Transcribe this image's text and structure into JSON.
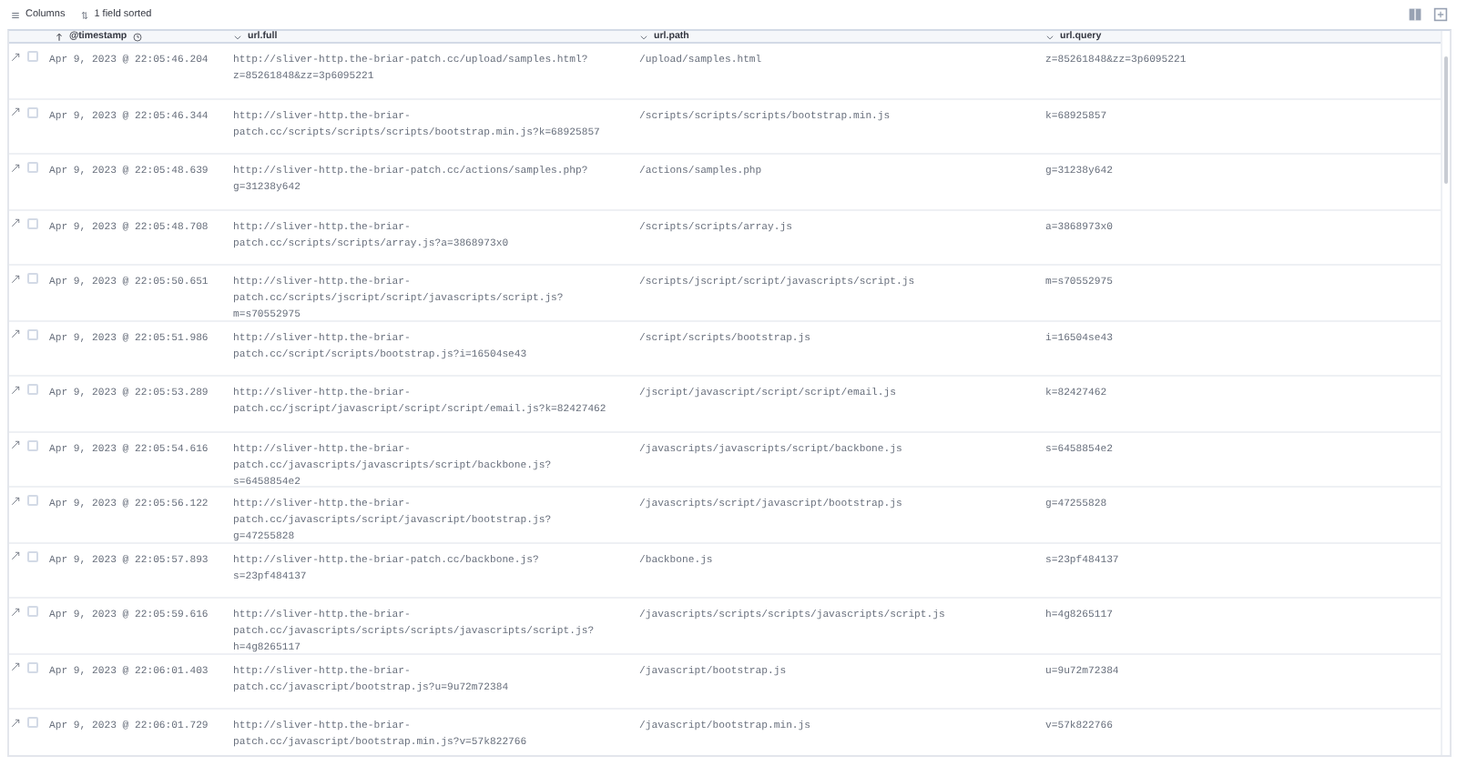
{
  "toolbar": {
    "columns_button": "Columns",
    "sort_button": "1 field sorted"
  },
  "table": {
    "columns": [
      {
        "label": "@timestamp",
        "sorted": true
      },
      {
        "label": "url.full",
        "sorted": false
      },
      {
        "label": "url.path",
        "sorted": false
      },
      {
        "label": "url.query",
        "sorted": false
      }
    ],
    "rows": [
      {
        "checked": false,
        "timestamp": "Apr 9, 2023 @ 22:05:46.204",
        "url_full": "http://sliver-http.the-briar-patch.cc/upload/samples.html?z=85261848&zz=3p6095221",
        "url_path": "/upload/samples.html",
        "url_query": "z=85261848&zz=3p6095221"
      },
      {
        "checked": false,
        "timestamp": "Apr 9, 2023 @ 22:05:46.344",
        "url_full": "http://sliver-http.the-briar-patch.cc/scripts/scripts/scripts/bootstrap.min.js?k=68925857",
        "url_path": "/scripts/scripts/scripts/bootstrap.min.js",
        "url_query": "k=68925857"
      },
      {
        "checked": false,
        "timestamp": "Apr 9, 2023 @ 22:05:48.639",
        "url_full": "http://sliver-http.the-briar-patch.cc/actions/samples.php?g=31238y642",
        "url_path": "/actions/samples.php",
        "url_query": "g=31238y642"
      },
      {
        "checked": false,
        "timestamp": "Apr 9, 2023 @ 22:05:48.708",
        "url_full": "http://sliver-http.the-briar-patch.cc/scripts/scripts/array.js?a=3868973x0",
        "url_path": "/scripts/scripts/array.js",
        "url_query": "a=3868973x0"
      },
      {
        "checked": false,
        "timestamp": "Apr 9, 2023 @ 22:05:50.651",
        "url_full": "http://sliver-http.the-briar-patch.cc/scripts/jscript/script/javascripts/script.js?m=s70552975",
        "url_path": "/scripts/jscript/script/javascripts/script.js",
        "url_query": "m=s70552975"
      },
      {
        "checked": false,
        "timestamp": "Apr 9, 2023 @ 22:05:51.986",
        "url_full": "http://sliver-http.the-briar-patch.cc/script/scripts/bootstrap.js?i=16504se43",
        "url_path": "/script/scripts/bootstrap.js",
        "url_query": "i=16504se43"
      },
      {
        "checked": false,
        "timestamp": "Apr 9, 2023 @ 22:05:53.289",
        "url_full": "http://sliver-http.the-briar-patch.cc/jscript/javascript/script/script/email.js?k=82427462",
        "url_path": "/jscript/javascript/script/script/email.js",
        "url_query": "k=82427462"
      },
      {
        "checked": false,
        "timestamp": "Apr 9, 2023 @ 22:05:54.616",
        "url_full": "http://sliver-http.the-briar-patch.cc/javascripts/javascripts/script/backbone.js?s=6458854e2",
        "url_path": "/javascripts/javascripts/script/backbone.js",
        "url_query": "s=6458854e2"
      },
      {
        "checked": false,
        "timestamp": "Apr 9, 2023 @ 22:05:56.122",
        "url_full": "http://sliver-http.the-briar-patch.cc/javascripts/script/javascript/bootstrap.js?g=47255828",
        "url_path": "/javascripts/script/javascript/bootstrap.js",
        "url_query": "g=47255828"
      },
      {
        "checked": false,
        "timestamp": "Apr 9, 2023 @ 22:05:57.893",
        "url_full": "http://sliver-http.the-briar-patch.cc/backbone.js?s=23pf484137",
        "url_path": "/backbone.js",
        "url_query": "s=23pf484137"
      },
      {
        "checked": false,
        "timestamp": "Apr 9, 2023 @ 22:05:59.616",
        "url_full": "http://sliver-http.the-briar-patch.cc/javascripts/scripts/scripts/javascripts/script.js?h=4g8265117",
        "url_path": "/javascripts/scripts/scripts/javascripts/script.js",
        "url_query": "h=4g8265117"
      },
      {
        "checked": false,
        "timestamp": "Apr 9, 2023 @ 22:06:01.403",
        "url_full": "http://sliver-http.the-briar-patch.cc/javascript/bootstrap.js?u=9u72m72384",
        "url_path": "/javascript/bootstrap.js",
        "url_query": "u=9u72m72384"
      },
      {
        "checked": false,
        "timestamp": "Apr 9, 2023 @ 22:06:01.729",
        "url_full": "http://sliver-http.the-briar-patch.cc/javascript/bootstrap.min.js?v=57k822766",
        "url_path": "/javascript/bootstrap.min.js",
        "url_query": "v=57k822766"
      }
    ]
  }
}
